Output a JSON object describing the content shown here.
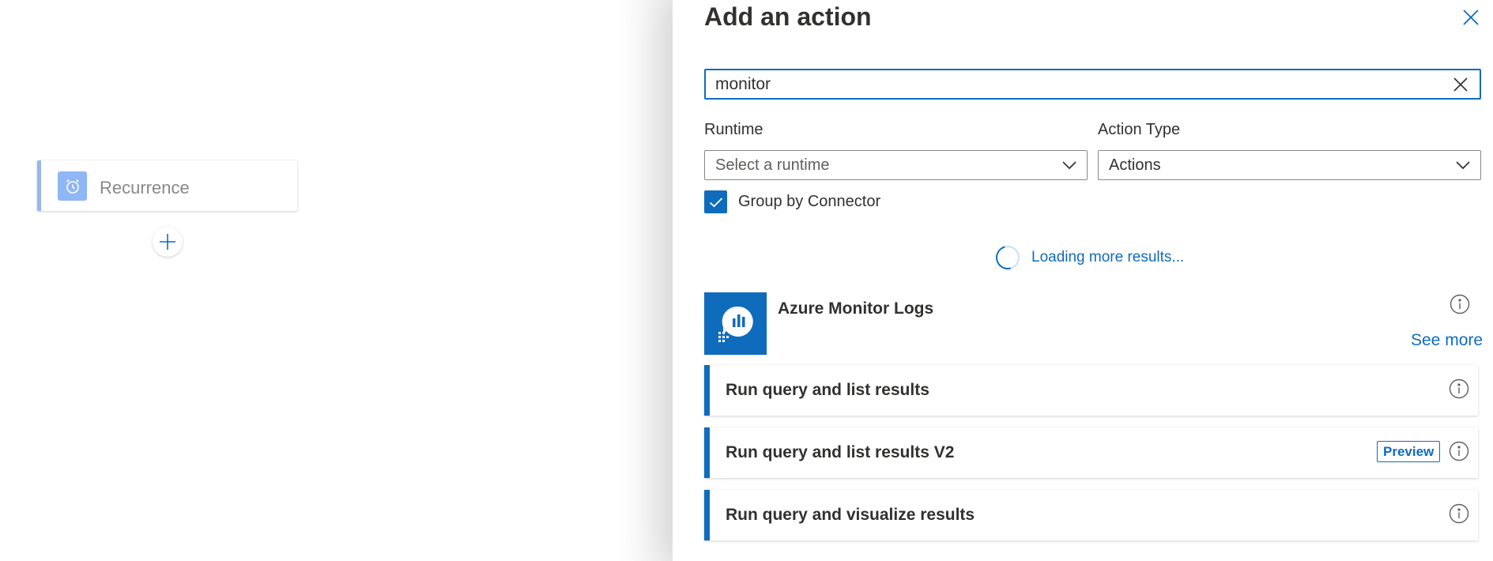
{
  "canvas": {
    "trigger": {
      "label": "Recurrence",
      "icon": "alarm-clock-icon",
      "accent": "#93b7f3"
    },
    "add_step_icon": "plus-icon"
  },
  "panel": {
    "title": "Add an action",
    "close_icon": "close-icon",
    "search": {
      "value": "monitor",
      "placeholder": "",
      "clear_icon": "clear-icon"
    },
    "runtime": {
      "label": "Runtime",
      "selected": "Select a runtime"
    },
    "action_type": {
      "label": "Action Type",
      "selected": "Actions"
    },
    "group_by_connector": {
      "label": "Group by Connector",
      "checked": true
    },
    "loading_text": "Loading more results...",
    "connector": {
      "name": "Azure Monitor Logs",
      "icon": "azure-monitor-logs-icon",
      "see_more": "See more"
    },
    "actions": [
      {
        "label": "Run query and list results",
        "badge": ""
      },
      {
        "label": "Run query and list results V2",
        "badge": "Preview"
      },
      {
        "label": "Run query and visualize results",
        "badge": ""
      }
    ],
    "accent_color": "#0f6cbd"
  }
}
